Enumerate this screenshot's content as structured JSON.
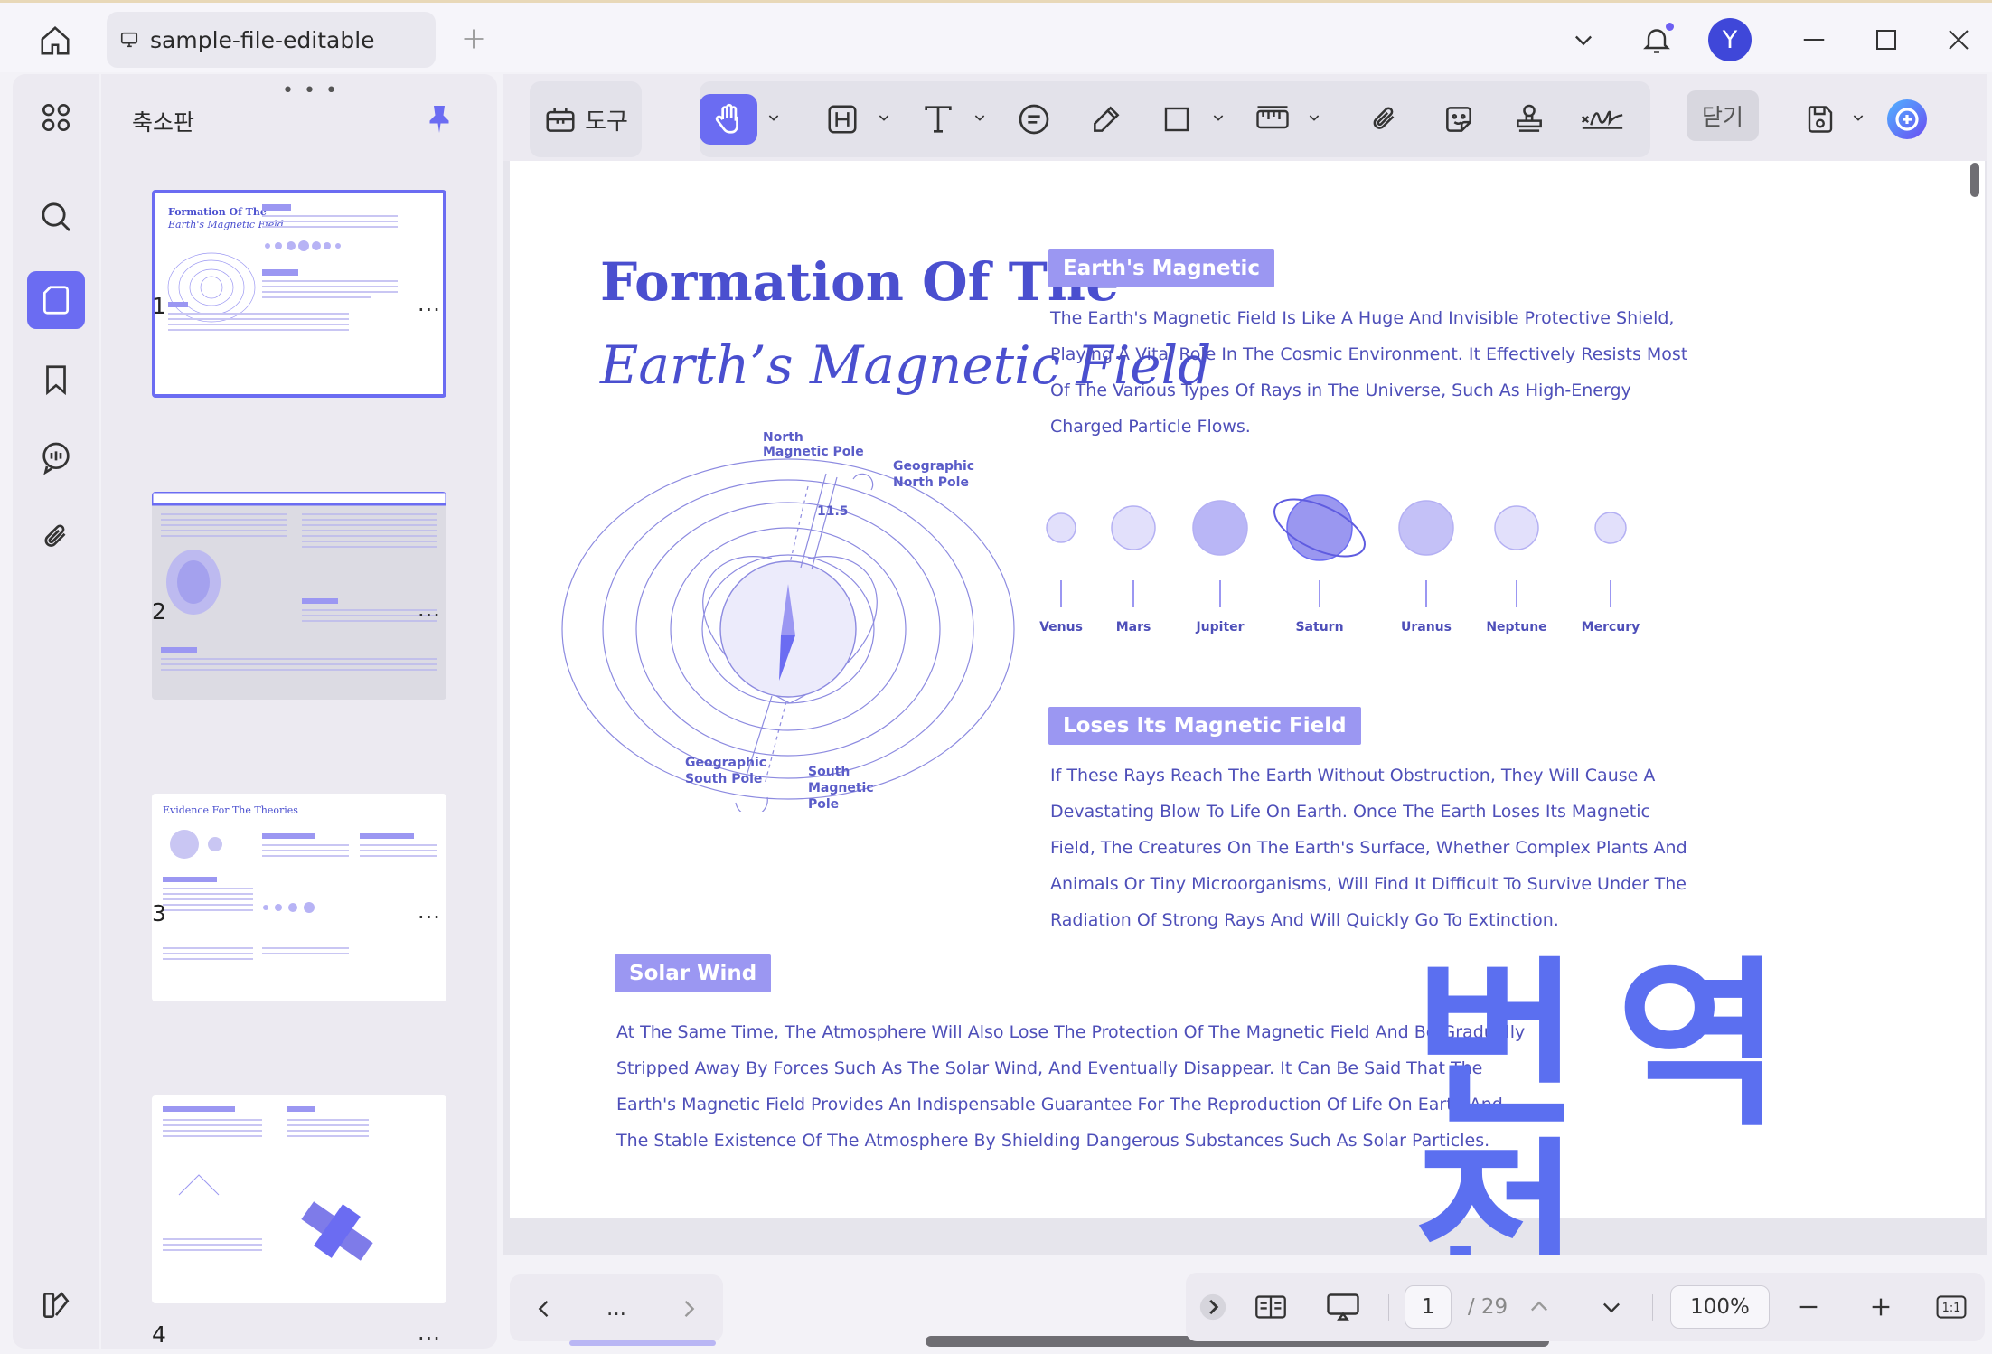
{
  "tab": {
    "title": "sample-file-editable"
  },
  "titlebar": {
    "avatar_letter": "Y"
  },
  "thumbnails": {
    "title": "축소판",
    "pages": [
      {
        "number": "1",
        "selected": true,
        "title_line1": "Formation Of The",
        "title_line2": "Earth's Magnetic Field"
      },
      {
        "number": "2",
        "selected": false
      },
      {
        "number": "3",
        "selected": false,
        "title": "Evidence For The Theories"
      },
      {
        "number": "4",
        "selected": false
      }
    ],
    "more_label": "..."
  },
  "toolbar": {
    "tools_label": "도구",
    "close_label": "닫기"
  },
  "page": {
    "title_line1": "Formation Of The",
    "title_line2": "Earth’s Magnetic Field",
    "sections": {
      "magnetic": {
        "heading": "Earth's Magnetic",
        "lines": [
          "The Earth's Magnetic Field Is Like A Huge And Invisible Protective Shield,",
          "Playing A Vital Role In The Cosmic Environment. It Effectively Resists Most",
          "Of The Various Types Of Rays in The Universe, Such As High-Energy",
          "Charged Particle Flows."
        ]
      },
      "loses": {
        "heading": "Loses Its Magnetic Field",
        "lines": [
          "If These Rays Reach The Earth Without Obstruction, They Will Cause A",
          "Devastating Blow To Life On Earth. Once The Earth Loses Its Magnetic",
          "Field, The Creatures On The Earth's Surface, Whether Complex Plants And",
          "Animals Or Tiny Microorganisms, Will Find It Difficult To Survive Under The",
          "Radiation Of Strong Rays And Will Quickly Go To Extinction."
        ]
      },
      "solar": {
        "heading": "Solar Wind",
        "lines": [
          "At The Same Time, The Atmosphere Will Also Lose The Protection Of The Magnetic Field And Be Gradually",
          "Stripped Away By Forces Such As The Solar Wind, And Eventually Disappear. It Can Be Said That The",
          "Earth's Magnetic Field Provides An Indispensable Guarantee For The Reproduction Of Life On Earth And",
          "The Stable Existence Of The Atmosphere By Shielding Dangerous Substances Such As Solar Particles."
        ]
      }
    },
    "diagram_labels": {
      "north_magnetic_1": "North",
      "north_magnetic_2": "Magnetic Pole",
      "geo_north_1": "Geographic",
      "geo_north_2": "North Pole",
      "geo_south_1": "Geographic",
      "geo_south_2": "South Pole",
      "south_magnetic_1": "South",
      "south_magnetic_2": "Magnetic",
      "south_magnetic_3": "Pole",
      "angle": "11.5"
    },
    "planets": [
      "Venus",
      "Mars",
      "Jupiter",
      "Saturn",
      "Uranus",
      "Neptune",
      "Mercury"
    ],
    "watermark": "번역 전"
  },
  "bottombar": {
    "more_label": "...",
    "current_page": "1",
    "total_pages": "/ 29",
    "zoom": "100%",
    "fit_label": "1:1"
  },
  "colors": {
    "accent": "#6b6cf2",
    "doc_text": "#4e4fb9",
    "pill": "#9b97f2",
    "watermark": "#5b6ff0"
  }
}
